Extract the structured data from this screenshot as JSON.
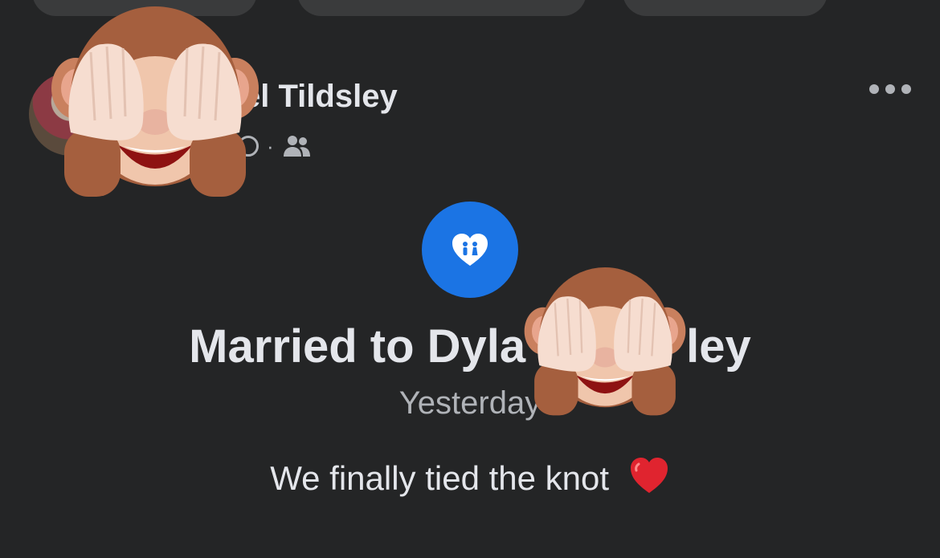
{
  "header": {
    "author_name_visible": "el Tildsley",
    "privacy_separator": "·",
    "audience_icon": "friends-icon",
    "more_icon": "more-horizontal-icon"
  },
  "life_event": {
    "icon": "heart-couple-icon",
    "icon_color": "#1b74e4",
    "title_left": "Married to Dyla",
    "title_right": "ley",
    "date": "Yesterday"
  },
  "post": {
    "text": "We finally tied the knot",
    "emoji": "red-heart-icon"
  },
  "overlays": {
    "sticker": "see-no-evil-monkey-icon"
  },
  "colors": {
    "background": "#242526",
    "text_primary": "#e4e6eb",
    "text_secondary": "#b0b3b8",
    "accent": "#1b74e4"
  }
}
